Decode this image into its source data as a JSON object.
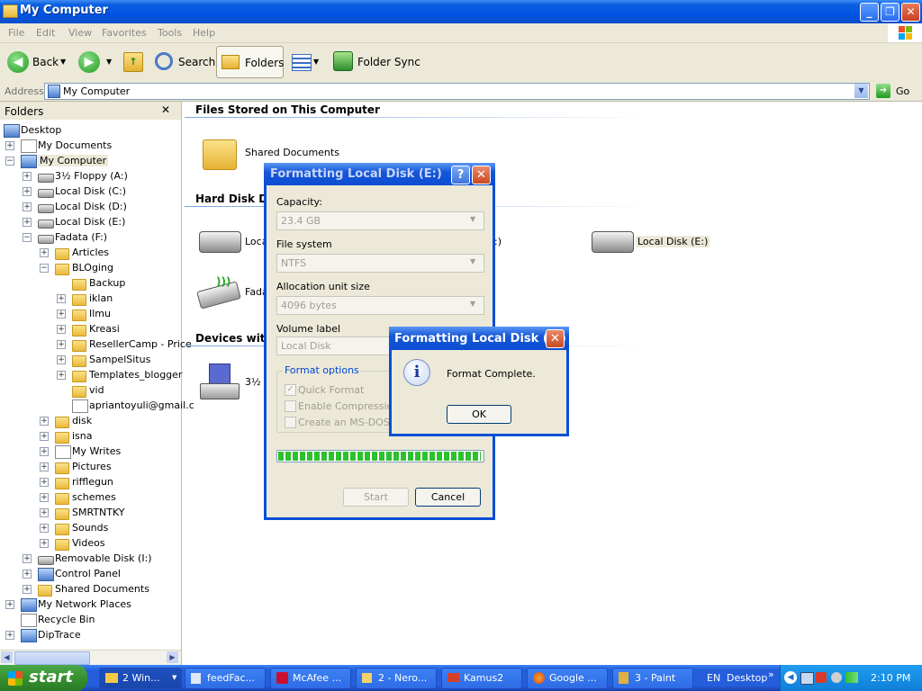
{
  "window": {
    "title": "My Computer"
  },
  "menu": [
    "File",
    "Edit",
    "View",
    "Favorites",
    "Tools",
    "Help"
  ],
  "toolbar": {
    "back": "Back",
    "search": "Search",
    "folders": "Folders",
    "folder_sync": "Folder Sync"
  },
  "address": {
    "label": "Address",
    "value": "My Computer",
    "go": "Go"
  },
  "folders_pane": {
    "title": "Folders",
    "close": "✕",
    "items": [
      {
        "label": "Desktop"
      },
      {
        "label": "My Documents"
      },
      {
        "label": "My Computer"
      },
      {
        "label": "3½ Floppy (A:)"
      },
      {
        "label": "Local Disk (C:)"
      },
      {
        "label": "Local Disk (D:)"
      },
      {
        "label": "Local Disk (E:)"
      },
      {
        "label": "Fadata (F:)"
      },
      {
        "label": "Articles"
      },
      {
        "label": "BLOging"
      },
      {
        "label": "Backup"
      },
      {
        "label": "iklan"
      },
      {
        "label": "Ilmu"
      },
      {
        "label": "Kreasi"
      },
      {
        "label": "ResellerCamp - Price"
      },
      {
        "label": "SampelSitus"
      },
      {
        "label": "Templates_blogger"
      },
      {
        "label": "vid"
      },
      {
        "label": "apriantoyuli@gmail.c"
      },
      {
        "label": "disk"
      },
      {
        "label": "isna"
      },
      {
        "label": "My Writes"
      },
      {
        "label": "Pictures"
      },
      {
        "label": "rifflegun"
      },
      {
        "label": "schemes"
      },
      {
        "label": "SMRTNTKY"
      },
      {
        "label": "Sounds"
      },
      {
        "label": "Videos"
      },
      {
        "label": "Removable Disk (I:)"
      },
      {
        "label": "Control Panel"
      },
      {
        "label": "Shared Documents"
      },
      {
        "label": "My Network Places"
      },
      {
        "label": "Recycle Bin"
      },
      {
        "label": "DipTrace"
      }
    ]
  },
  "main": {
    "section_files": "Files Stored on This Computer",
    "shared_docs": "Shared Documents",
    "section_hdd": "Hard Disk Driv",
    "disk_c_partial": "Loca",
    "disk_d_partial": ":)",
    "disk_e": "Local Disk (E:)",
    "fadata_partial": "Fada",
    "section_devices": "Devices with R",
    "floppy_partial": "3½"
  },
  "format_dialog": {
    "title": "Formatting Local Disk (E:)",
    "capacity_label": "Capacity:",
    "capacity_value": "23.4 GB",
    "fs_label": "File system",
    "fs_value": "NTFS",
    "alloc_label": "Allocation unit size",
    "alloc_value": "4096 bytes",
    "volume_label": "Volume label",
    "volume_value": "Local Disk",
    "options_label": "Format options",
    "quick_format": "Quick Format",
    "compression": "Enable Compression",
    "msdos": "Create an MS-DOS st",
    "progress": 1.0,
    "start": "Start",
    "cancel": "Cancel"
  },
  "complete_dialog": {
    "title": "Formatting Local Disk (E:)",
    "message": "Format Complete.",
    "ok": "OK"
  },
  "taskbar": {
    "start": "start",
    "tasks": [
      "2 Win...",
      "feedFac...",
      "McAfee ...",
      "2 - Nero...",
      "Kamus2",
      "Google ...",
      "3 - Paint"
    ],
    "lang": "EN",
    "desktop": "Desktop",
    "time": "2:10 PM"
  },
  "colors": {
    "xp_blue": "#0054e3",
    "dialog_bg": "#ece9d8",
    "progress_green": "#2ec02e"
  }
}
